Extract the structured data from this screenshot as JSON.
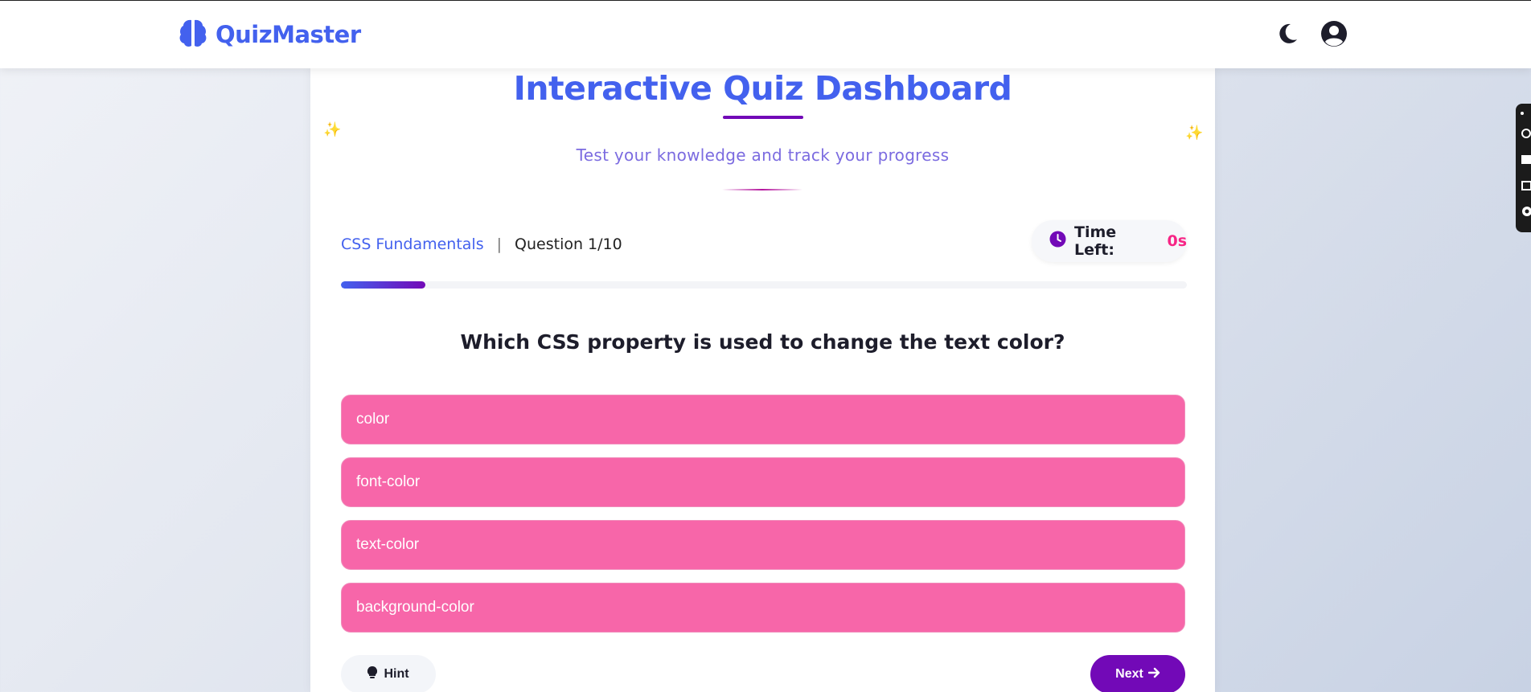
{
  "app": {
    "name": "QuizMaster"
  },
  "header": {
    "title": "Interactive Quiz Dashboard",
    "subtitle": "Test your knowledge and track your progress"
  },
  "quiz": {
    "category": "CSS Fundamentals",
    "separator": "|",
    "question_counter": "Question 1/10",
    "timer_label": "Time Left:",
    "timer_value": "0s",
    "progress_fraction": 0.1,
    "question": "Which CSS property is used to change the text color?",
    "options": [
      "color",
      "font-color",
      "text-color",
      "background-color"
    ]
  },
  "actions": {
    "hint_label": "Hint",
    "next_label": "Next"
  },
  "icons": {
    "brand": "brain-icon",
    "theme": "moon-icon",
    "account": "user-circle-icon",
    "timer": "clock-icon",
    "hint": "lightbulb-icon",
    "next": "arrow-right-icon",
    "decor": "sparkle-icon"
  },
  "colors": {
    "primary": "#4361ee",
    "accent": "#7209b7",
    "option": "#f766a9",
    "timer_value": "#f72585"
  }
}
